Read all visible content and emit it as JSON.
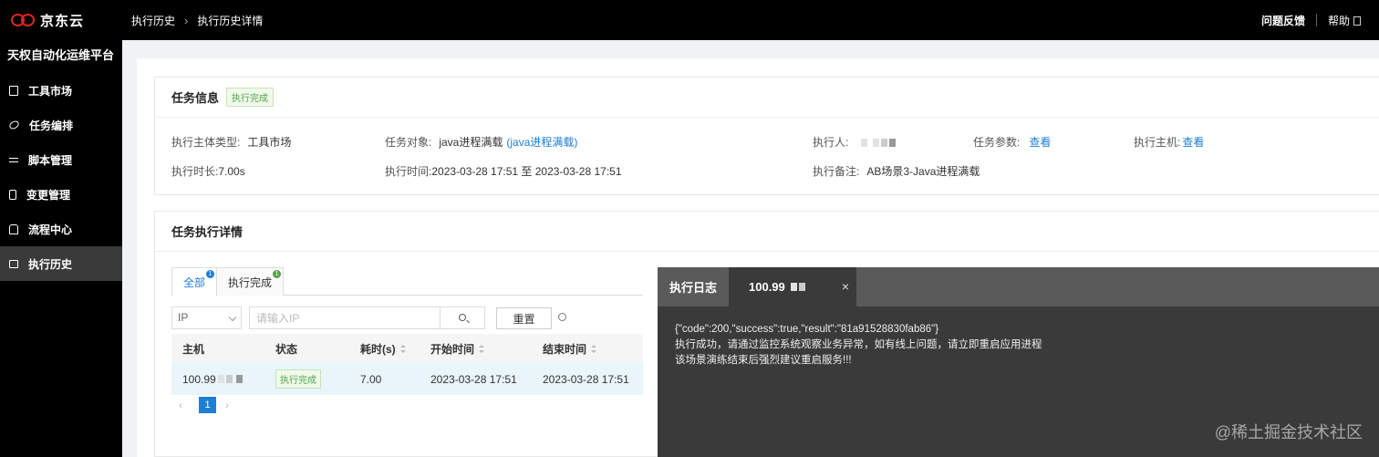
{
  "header": {
    "brand": "京东云",
    "breadcrumb": [
      "执行历史",
      "执行历史详情"
    ],
    "feedback": "问题反馈",
    "help": "帮助"
  },
  "sidebar": {
    "platform": "天权自动化运维平台",
    "items": [
      {
        "label": "工具市场",
        "icon": "doc-icon"
      },
      {
        "label": "任务编排",
        "icon": "link-icon"
      },
      {
        "label": "脚本管理",
        "icon": "swap-icon"
      },
      {
        "label": "变更管理",
        "icon": "phone-icon"
      },
      {
        "label": "流程中心",
        "icon": "flow-icon"
      },
      {
        "label": "执行历史",
        "icon": "folder-icon",
        "active": true
      }
    ]
  },
  "task_info": {
    "title": "任务信息",
    "status": "执行完成",
    "subject_type_label": "执行主体类型:",
    "subject_type": "工具市场",
    "target_label": "任务对象:",
    "target": "java进程满载",
    "target_link": "(java进程满载)",
    "executor_label": "执行人:",
    "params_label": "任务参数:",
    "params_link": "查看",
    "host_label": "执行主机:",
    "host_link": "查看",
    "duration_label": "执行时长:",
    "duration": "7.00s",
    "time_label": "执行时间:",
    "time": "2023-03-28 17:51 至 2023-03-28 17:51",
    "remark_label": "执行备注:",
    "remark": "AB场景3-Java进程满载"
  },
  "detail": {
    "title": "任务执行详情",
    "tabs": [
      {
        "label": "全部",
        "count": "1"
      },
      {
        "label": "执行完成",
        "count": "1"
      }
    ],
    "filter": {
      "select_value": "IP",
      "search_placeholder": "请输入IP",
      "reset": "重置"
    },
    "table": {
      "headers": [
        "主机",
        "状态",
        "耗时(s)",
        "开始时间",
        "结束时间"
      ],
      "rows": [
        {
          "host": "100.99",
          "status": "执行完成",
          "duration": "7.00",
          "start": "2023-03-28 17:51",
          "end": "2023-03-28 17:51"
        }
      ]
    },
    "pagination": {
      "prev": "‹",
      "current": "1",
      "next": "›"
    }
  },
  "log": {
    "title": "执行日志",
    "tab": "100.99",
    "close": "×",
    "lines": [
      "{\"code\":200,\"success\":true,\"result\":\"81a91528830fab86\"}",
      "执行成功，请通过监控系统观察业务异常，如有线上问题，请立即重启应用进程",
      "该场景演练结束后强烈建议重启服务!!!"
    ]
  },
  "watermark": "@稀土掘金技术社区"
}
